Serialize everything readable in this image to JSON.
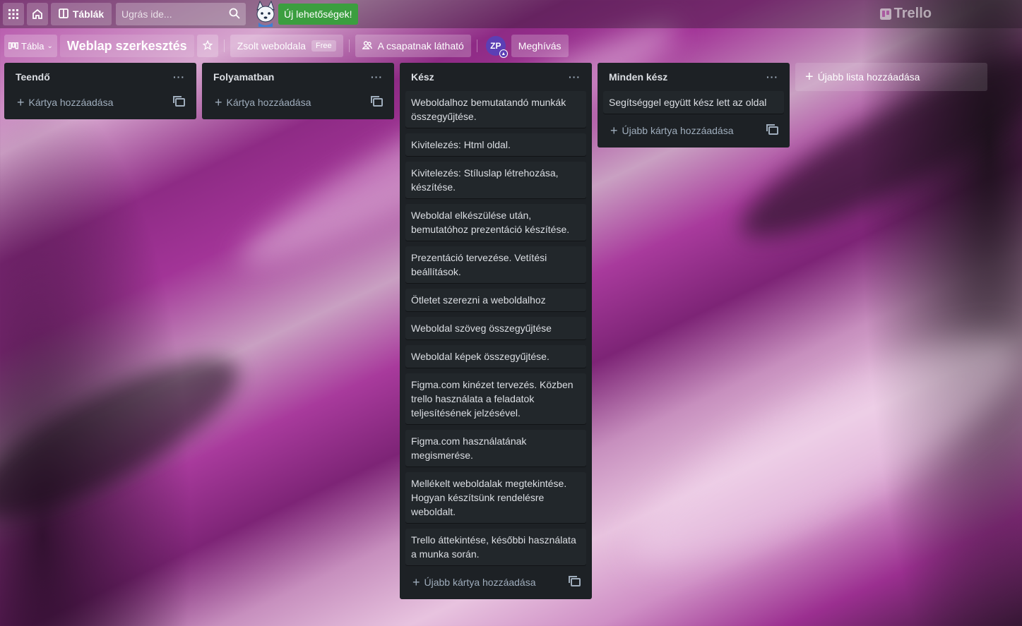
{
  "topbar": {
    "boards_label": "Táblák",
    "search_placeholder": "Ugrás ide...",
    "new_features_label": "Új lehetőségek!",
    "logo_text": "Trello"
  },
  "board": {
    "view_label": "Tábla",
    "title": "Weblap szerkesztés",
    "workspace_label": "Zsolt weboldala",
    "workspace_badge": "Free",
    "visibility_label": "A csapatnak látható",
    "avatar_initials": "ZP",
    "invite_label": "Meghívás"
  },
  "lists": [
    {
      "title": "Teendő",
      "cards": [],
      "add_label": "Kártya hozzáadása"
    },
    {
      "title": "Folyamatban",
      "cards": [],
      "add_label": "Kártya hozzáadása"
    },
    {
      "title": "Kész",
      "cards": [
        "Weboldalhoz bemutatandó munkák összegyűjtése.",
        "Kivitelezés: Html oldal.",
        "Kivitelezés: Stíluslap létrehozása, készítése.",
        "Weboldal elkészülése után, bemutatóhoz prezentáció készítése.",
        "Prezentáció tervezése. Vetítési beállítások.",
        "Ötletet szerezni a weboldalhoz",
        "Weboldal szöveg összegyűjtése",
        "Weboldal képek összegyűjtése.",
        "Figma.com kinézet tervezés. Közben trello használata a feladatok teljesítésének jelzésével.",
        "Figma.com használatának megismerése.",
        "Mellékelt weboldalak megtekintése. Hogyan készítsünk rendelésre weboldalt.",
        "Trello áttekintése, későbbi használata a munka során."
      ],
      "add_label": "Újabb kártya hozzáadása"
    },
    {
      "title": "Minden kész",
      "cards": [
        "Segítséggel együtt kész lett az oldal"
      ],
      "add_label": "Újabb kártya hozzáadása"
    }
  ],
  "add_list_label": "Újabb lista hozzáadása",
  "colors": {
    "list_bg": "#1d2125",
    "card_bg": "#22272b",
    "new_features_bg": "#3b9e3f",
    "avatar_bg": "#5c3fb5"
  },
  "icons": {
    "apps": "apps-grid-icon",
    "home": "home-icon",
    "boards": "boards-icon",
    "search": "search-icon",
    "star": "star-icon",
    "visibility": "team-visibility-icon",
    "list_menu": "more-dots-icon",
    "template": "card-template-icon",
    "add": "plus-icon"
  }
}
